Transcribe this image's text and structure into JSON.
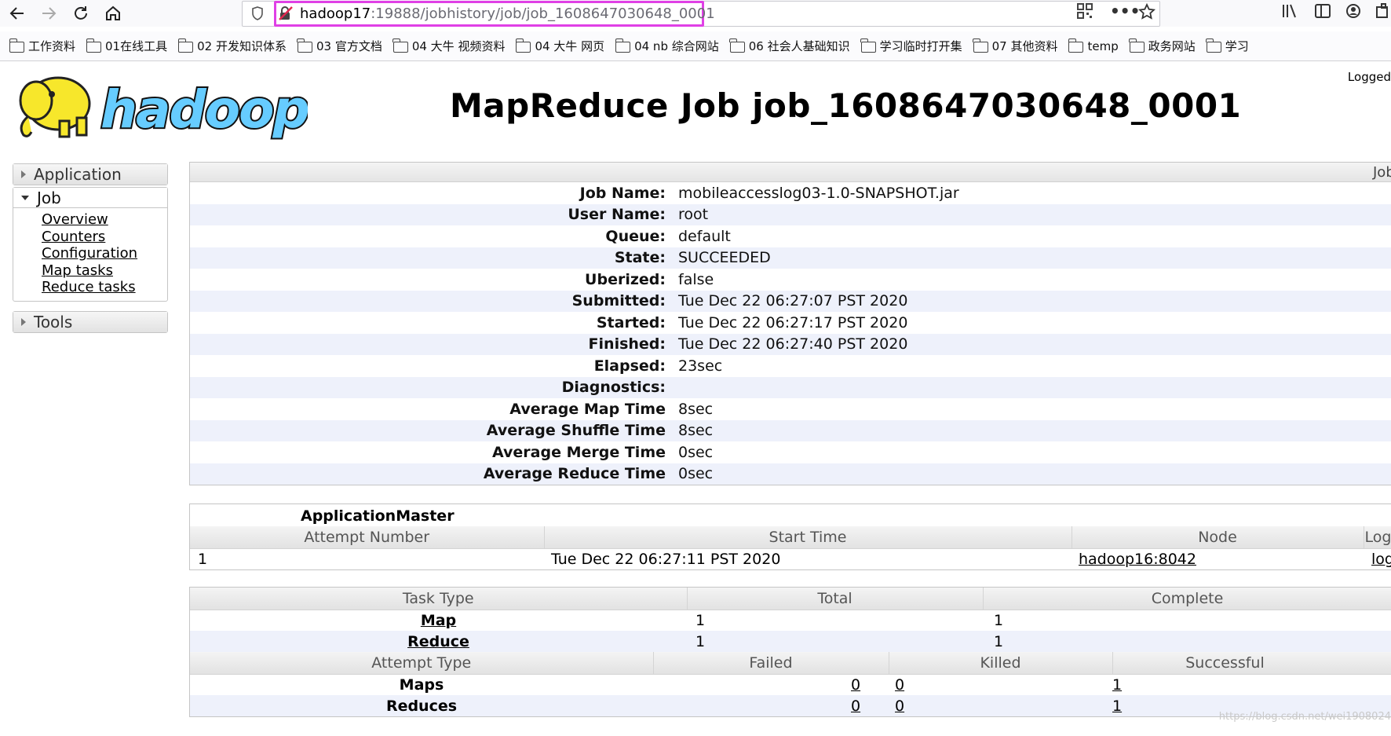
{
  "browser": {
    "url_host": "hadoop17",
    "url_rest": ":19888/jobhistory/job/job_1608647030648_0001",
    "bookmarks": [
      "工作资料",
      "01在线工具",
      "02 开发知识体系",
      "03 官方文档",
      "04 大牛 视频资料",
      "04 大牛 网页",
      "04 nb 综合网站",
      "06 社会人基础知识",
      "学习临时打开集",
      "07 其他资料",
      "temp",
      "政务网站",
      "学习"
    ]
  },
  "header": {
    "logo_text": "hadoop",
    "title": "MapReduce Job job_1608647030648_0001",
    "logged": "Logged"
  },
  "sidebar": {
    "application": "Application",
    "job": "Job",
    "job_links": [
      "Overview",
      "Counters",
      "Configuration",
      "Map tasks",
      "Reduce tasks"
    ],
    "tools": "Tools"
  },
  "job_panel": {
    "head": "Job",
    "rows": [
      {
        "label": "Job Name:",
        "value": "mobileaccesslog03-1.0-SNAPSHOT.jar"
      },
      {
        "label": "User Name:",
        "value": "root"
      },
      {
        "label": "Queue:",
        "value": "default"
      },
      {
        "label": "State:",
        "value": "SUCCEEDED"
      },
      {
        "label": "Uberized:",
        "value": "false"
      },
      {
        "label": "Submitted:",
        "value": "Tue Dec 22 06:27:07 PST 2020"
      },
      {
        "label": "Started:",
        "value": "Tue Dec 22 06:27:17 PST 2020"
      },
      {
        "label": "Finished:",
        "value": "Tue Dec 22 06:27:40 PST 2020"
      },
      {
        "label": "Elapsed:",
        "value": "23sec"
      },
      {
        "label": "Diagnostics:",
        "value": ""
      },
      {
        "label": "Average Map Time",
        "value": "8sec"
      },
      {
        "label": "Average Shuffle Time",
        "value": "8sec"
      },
      {
        "label": "Average Merge Time",
        "value": "0sec"
      },
      {
        "label": "Average Reduce Time",
        "value": "0sec"
      }
    ]
  },
  "am": {
    "caption": "ApplicationMaster",
    "headers": [
      "Attempt Number",
      "Start Time",
      "Node",
      "Logs"
    ],
    "row": {
      "attempt": "1",
      "start": "Tue Dec 22 06:27:11 PST 2020",
      "node": "hadoop16:8042",
      "logs": "logs"
    }
  },
  "tasks": {
    "headers": [
      "Task Type",
      "Total",
      "Complete"
    ],
    "rows": [
      {
        "type": "Map",
        "total": "1",
        "complete": "1"
      },
      {
        "type": "Reduce",
        "total": "1",
        "complete": "1"
      }
    ],
    "attempt_headers": [
      "Attempt Type",
      "Failed",
      "Killed",
      "Successful"
    ],
    "attempt_rows": [
      {
        "type": "Maps",
        "failed": "0",
        "killed": "0",
        "successful": "1"
      },
      {
        "type": "Reduces",
        "failed": "0",
        "killed": "0",
        "successful": "1"
      }
    ]
  },
  "watermark": "https://blog.csdn.net/wei1908024",
  "colors": {
    "focus_ring": "#e040e6",
    "row_alt": "#eef1fb",
    "logo_yellow": "#f7e72b",
    "logo_blue": "#66ccff"
  }
}
